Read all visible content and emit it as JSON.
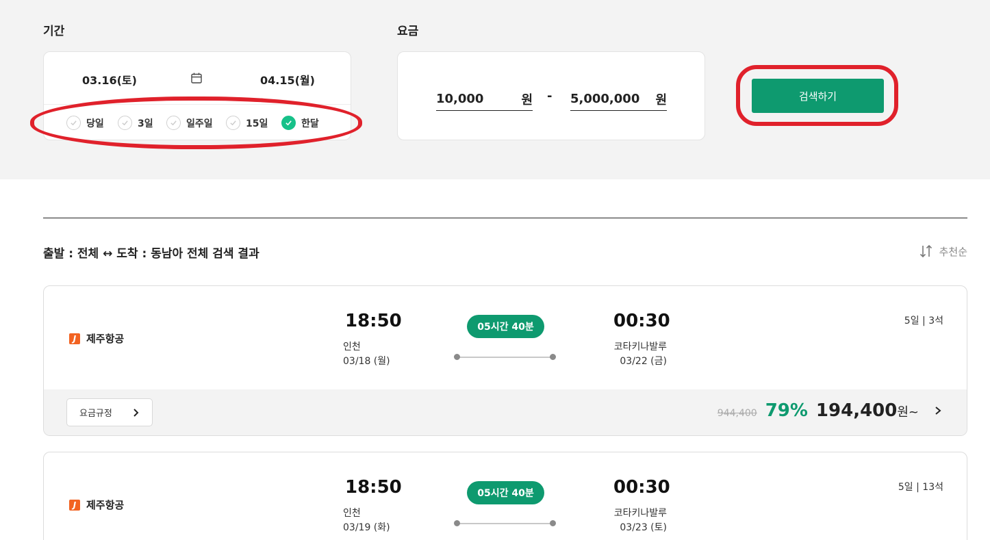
{
  "filter": {
    "period_label": "기간",
    "start_date": "03.16(토)",
    "end_date": "04.15(월)",
    "chips": [
      {
        "label": "당일",
        "selected": false
      },
      {
        "label": "3일",
        "selected": false
      },
      {
        "label": "일주일",
        "selected": false
      },
      {
        "label": "15일",
        "selected": false
      },
      {
        "label": "한달",
        "selected": true
      }
    ],
    "fare_label": "요금",
    "min_price": "10,000",
    "max_price": "5,000,000",
    "currency_unit": "원",
    "range_separator": "-",
    "search_label": "검색하기"
  },
  "results": {
    "title": "출발 : 전체 ↔ 도착 : 동남아 전체 검색 결과",
    "sort_label": "추천순",
    "cards": [
      {
        "airline": "제주항공",
        "logo_char": "J",
        "dep_time": "18:50",
        "dep_city": "인천",
        "dep_date": "03/18 (월)",
        "duration": "05시간 40분",
        "arr_time": "00:30",
        "arr_city": "코타키나발루",
        "arr_date": "03/22 (금)",
        "seat_info": "5일 | 3석",
        "fare_rule": "요금규정",
        "original_price": "944,400",
        "discount": "79%",
        "price": "194,400",
        "price_suffix": "원~"
      },
      {
        "airline": "제주항공",
        "logo_char": "J",
        "dep_time": "18:50",
        "dep_city": "인천",
        "dep_date": "03/19 (화)",
        "duration": "05시간 40분",
        "arr_time": "00:30",
        "arr_city": "코타키나발루",
        "arr_date": "03/23 (토)",
        "seat_info": "5일 | 13석"
      }
    ]
  },
  "colors": {
    "accent": "#0e9a6f",
    "check_active": "#17c189",
    "highlight": "#e0212b",
    "airline_logo": "#f26322"
  }
}
